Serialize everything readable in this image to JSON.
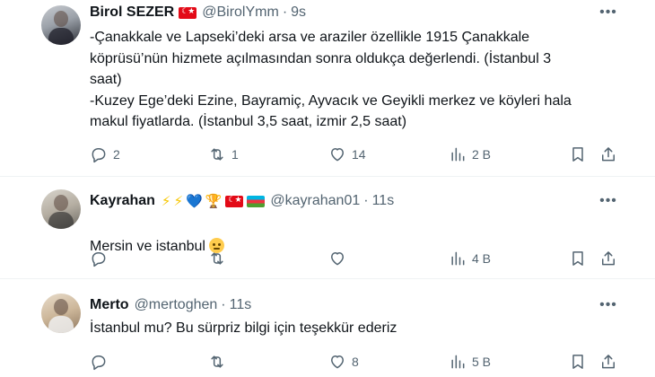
{
  "tweets": [
    {
      "name": "Birol SEZER",
      "badges": [
        "flag-turkey"
      ],
      "handle": "@BirolYmm",
      "time": "9s",
      "text": "-Çanakkale ve Lapseki’deki arsa ve araziler özellikle 1915 Çanakkale\nköprüsü’nün hizmete açılmasından sonra oldukça değerlendi. (İstanbul 3\nsaat)\n-Kuzey Ege’deki Ezine, Bayramiç, Ayvacık ve Geyikli merkez ve köyleri hala\nmakul fiyatlarda. (İstanbul 3,5 saat, izmir 2,5 saat)",
      "replies": "2",
      "reposts": "1",
      "likes": "14",
      "views": "2 B"
    },
    {
      "name": "Kayrahan",
      "badges": [
        "high-voltage-emoji",
        "high-voltage-emoji",
        "blue-heart-emoji",
        "trophy-emoji",
        "flag-turkey",
        "flag-azerbaijan"
      ],
      "handle": "@kayrahan01",
      "time": "11s",
      "text": "Mersin ve istanbul",
      "text_emoji": "thinking-face-emoji",
      "replies": "",
      "reposts": "",
      "likes": "",
      "views": "4 B"
    },
    {
      "name": "Merto",
      "badges": [],
      "handle": "@mertoghen",
      "time": "11s",
      "text": "İstanbul mu? Bu sürpriz bilgi için teşekkür ederiz",
      "replies": "",
      "reposts": "",
      "likes": "8",
      "views": "5 B"
    }
  ],
  "separator": "·",
  "emoji_glyphs": {
    "high-voltage": "⚡",
    "blue-heart": "💙",
    "trophy": "🏆"
  },
  "colors": {
    "text": "#0f1419",
    "muted": "#536471",
    "divider": "#eff3f4",
    "voltage": "#f7c600",
    "heart": "#5dadec",
    "trophy": "#f4b400"
  }
}
